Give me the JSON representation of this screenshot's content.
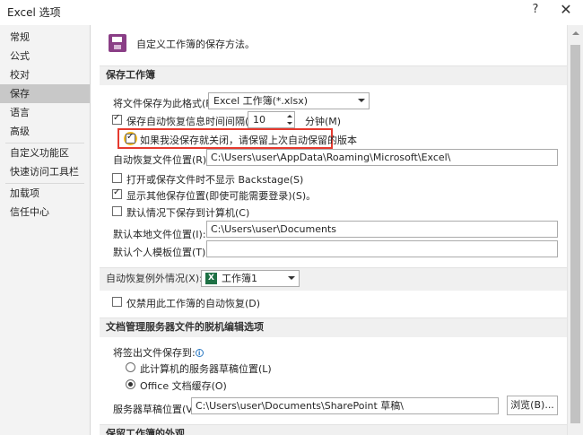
{
  "window": {
    "title": "Excel 选项",
    "help": "?",
    "close": "✕"
  },
  "nav": {
    "items": [
      {
        "label": "常规"
      },
      {
        "label": "公式"
      },
      {
        "label": "校对"
      },
      {
        "label": "保存",
        "selected": true
      },
      {
        "label": "语言"
      },
      {
        "label": "高级"
      },
      {
        "label": "自定义功能区"
      },
      {
        "label": "快速访问工具栏"
      },
      {
        "label": "加载项"
      },
      {
        "label": "信任中心"
      }
    ]
  },
  "header": {
    "icon": "floppy-disk-icon",
    "text": "自定义工作簿的保存方法。"
  },
  "save_workbooks": {
    "section_title": "保存工作簿",
    "format_label": "将文件保存为此格式(F):",
    "format_value": "Excel 工作簿(*.xlsx)",
    "autorecover_label": "保存自动恢复信息时间间隔(A)",
    "autorecover_checked": true,
    "autorecover_minutes": "10",
    "minutes_label": "分钟(M)",
    "keep_last_label": "如果我没保存就关闭，请保留上次自动保留的版本",
    "keep_last_checked": true,
    "autorecover_location_label": "自动恢复文件位置(R):",
    "autorecover_location_value": "C:\\Users\\user\\AppData\\Roaming\\Microsoft\\Excel\\",
    "no_backstage_label": "打开或保存文件时不显示 Backstage(S)",
    "no_backstage_checked": false,
    "show_additional_label": "显示其他保存位置(即使可能需要登录)(S)。",
    "show_additional_checked": true,
    "save_to_computer_label": "默认情况下保存到计算机(C)",
    "save_to_computer_checked": false,
    "local_location_label": "默认本地文件位置(I):",
    "local_location_value": "C:\\Users\\user\\Documents",
    "template_location_label": "默认个人模板位置(T):",
    "template_location_value": ""
  },
  "autorecover_exceptions": {
    "label": "自动恢复例外情况(X):",
    "workbook": "工作簿1",
    "excel_icon_letter": "X",
    "disable_label": "仅禁用此工作簿的自动恢复(D)",
    "disable_checked": false
  },
  "offline_editing": {
    "section_title": "文档管理服务器文件的脱机编辑选项",
    "save_checkedout_label": "将签出文件保存到:",
    "info_icon": "info-icon",
    "option_server_label": "此计算机的服务器草稿位置(L)",
    "option_cache_label": "Office 文档缓存(O)",
    "selected_option": "cache",
    "server_drafts_label": "服务器草稿位置(V):",
    "server_drafts_value": "C:\\Users\\user\\Documents\\SharePoint 草稿\\",
    "browse_label": "浏览(B)..."
  },
  "preserve_visual": {
    "section_title": "保留工作簿的外观"
  }
}
